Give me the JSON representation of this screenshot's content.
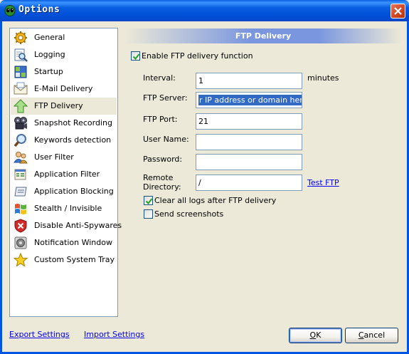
{
  "window": {
    "title": "Options"
  },
  "sidebar": {
    "items": [
      {
        "label": "General",
        "icon": "gear-icon"
      },
      {
        "label": "Logging",
        "icon": "magnifier-document-icon"
      },
      {
        "label": "Startup",
        "icon": "startup-icon"
      },
      {
        "label": "E-Mail Delivery",
        "icon": "envelope-icon"
      },
      {
        "label": "FTP Delivery",
        "icon": "up-arrow-icon"
      },
      {
        "label": "Snapshot Recording",
        "icon": "camera-reel-icon"
      },
      {
        "label": "Keywords detection",
        "icon": "magnifier-icon"
      },
      {
        "label": "User Filter",
        "icon": "users-icon"
      },
      {
        "label": "Application Filter",
        "icon": "app-filter-icon"
      },
      {
        "label": "Application Blocking",
        "icon": "app-blocking-icon"
      },
      {
        "label": "Stealth / Invisible",
        "icon": "windows-flag-icon"
      },
      {
        "label": "Disable Anti-Spywares",
        "icon": "shield-icon"
      },
      {
        "label": "Notification Window",
        "icon": "notification-icon"
      },
      {
        "label": "Custom System Tray",
        "icon": "star-icon"
      }
    ],
    "selected": "FTP Delivery"
  },
  "panel": {
    "header": "FTP Delivery",
    "enable_label": "Enable FTP delivery function",
    "enable_checked": true,
    "interval_label": "Interval:",
    "interval_value": "1",
    "interval_unit": "minutes",
    "server_label": "FTP Server:",
    "server_value": "r IP address or domain here>",
    "port_label": "FTP Port:",
    "port_value": "21",
    "username_label": "User Name:",
    "username_value": "",
    "password_label": "Password:",
    "password_value": "",
    "remote_dir_label_1": "Remote",
    "remote_dir_label_2": "Directory:",
    "remote_dir_value": "/",
    "test_ftp": "Test FTP",
    "clear_logs_label": "Clear all logs after FTP delivery",
    "clear_logs_checked": true,
    "send_screenshots_label": "Send screenshots",
    "send_screenshots_checked": false
  },
  "footer": {
    "export_settings": "Export Settings",
    "import_settings": "Import Settings",
    "ok_rest": "K",
    "ok_underline": "O",
    "cancel_underline": "C",
    "cancel_rest": "ancel"
  },
  "colors": {
    "titlebar": "#0a5fe0",
    "header_band": "#7a96df",
    "link": "#0000ee",
    "selection": "#316ac5"
  }
}
